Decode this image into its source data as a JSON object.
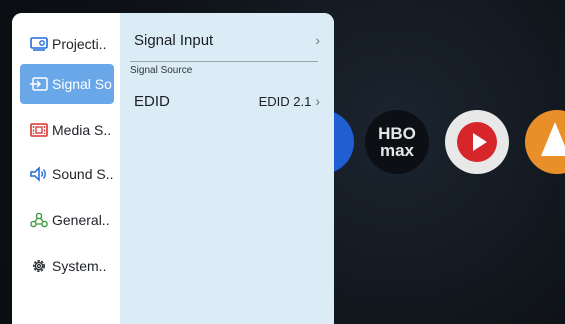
{
  "sidebar": {
    "items": [
      {
        "label": "Projecti..",
        "icon": "projector-icon"
      },
      {
        "label": "Signal So",
        "icon": "signal-input-icon",
        "active": true
      },
      {
        "label": "Media S..",
        "icon": "film-strip-icon"
      },
      {
        "label": "Sound S..",
        "icon": "speaker-icon"
      },
      {
        "label": "General..",
        "icon": "general-settings-icon"
      },
      {
        "label": "System..",
        "icon": "gear-icon"
      }
    ]
  },
  "content": {
    "signal_input_label": "Signal Input",
    "section_title": "Signal Source",
    "edid_label": "EDID",
    "edid_value": "EDID 2.1"
  },
  "background": {
    "hbo_line1": "HBO",
    "hbo_line2": "max"
  },
  "colors": {
    "active_bg": "#6aa7e8",
    "content_bg": "#dcecf6",
    "sidebar_bg": "#ffffff"
  }
}
